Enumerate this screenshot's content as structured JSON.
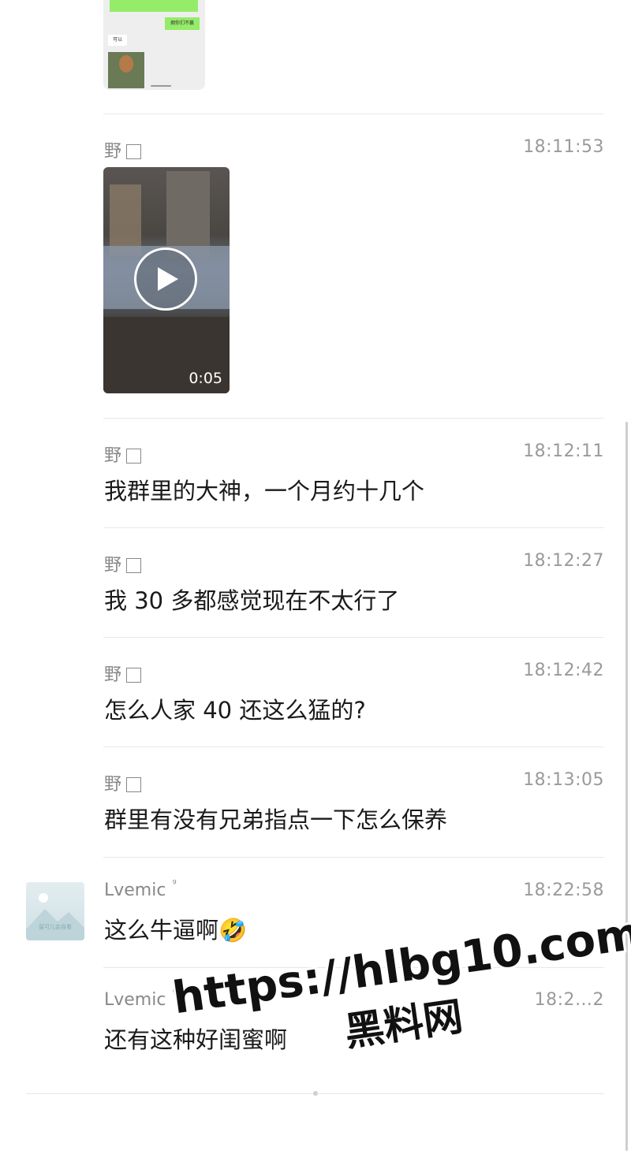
{
  "top_image": {
    "green_reply": "拥你们不赢",
    "white_reply": "可以"
  },
  "messages": [
    {
      "sender": "野",
      "time": "18:11:53",
      "type": "video",
      "duration": "0:05"
    },
    {
      "sender": "野",
      "time": "18:12:11",
      "text": "我群里的大神，一个月约十几个"
    },
    {
      "sender": "野",
      "time": "18:12:27",
      "text": "我 30 多都感觉现在不太行了"
    },
    {
      "sender": "野",
      "time": "18:12:42",
      "text": "怎么人家 40 还这么猛的?"
    },
    {
      "sender": "野",
      "time": "18:13:05",
      "text": "群里有没有兄弟指点一下怎么保养"
    },
    {
      "sender": "Lvemic",
      "sender_badge": "⁹",
      "time": "18:22:58",
      "text": "这么牛逼啊🤣",
      "avatar_caption": "留可儿会自看"
    },
    {
      "sender": "Lvemic",
      "sender_badge": "⁹",
      "time": "18:2…2",
      "text": "还有这种好闺蜜啊"
    }
  ],
  "watermark": {
    "url": "https://hlbg10.com",
    "site": "黑料网"
  },
  "colors": {
    "bubble_green": "#95ec69",
    "meta_gray": "#888888",
    "text_dark": "#1a1a1a"
  }
}
